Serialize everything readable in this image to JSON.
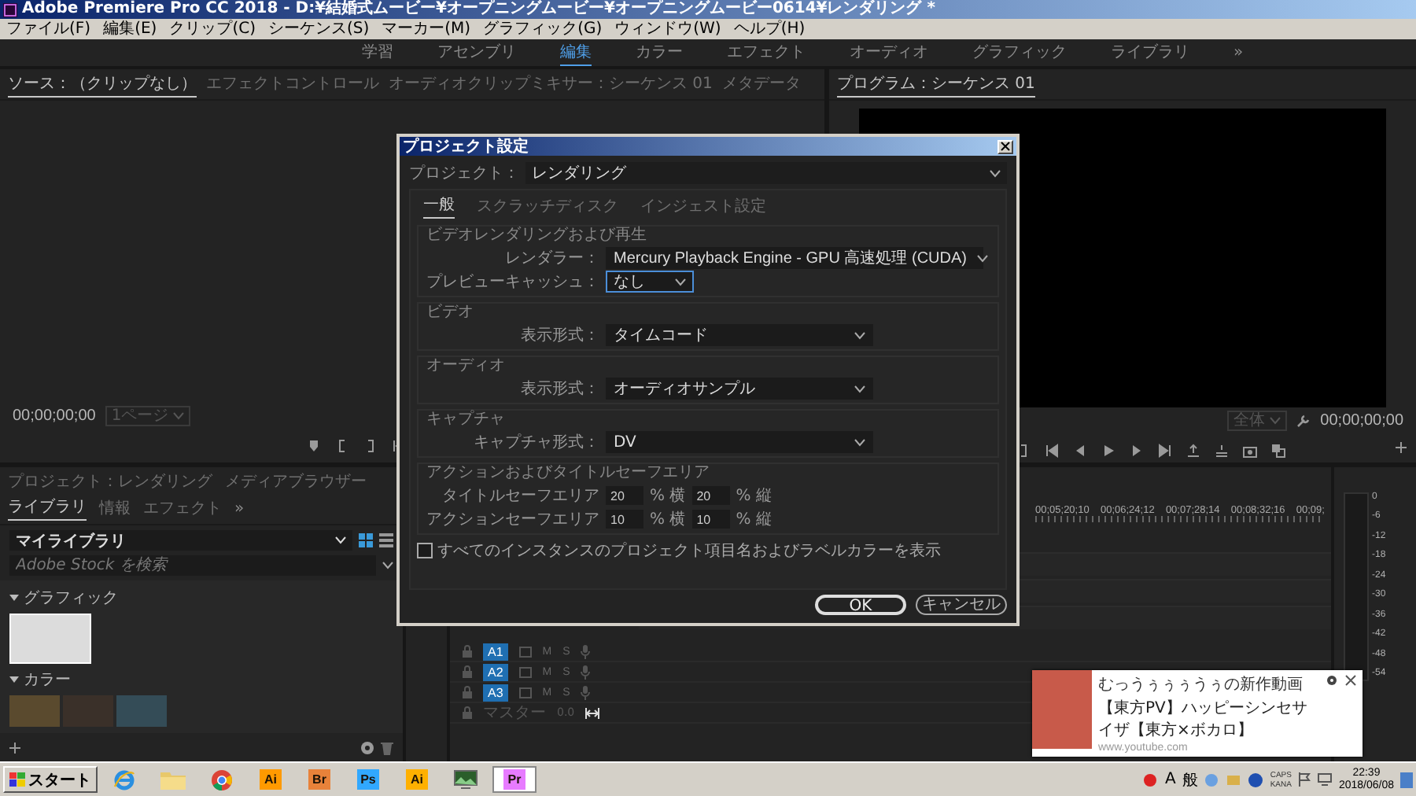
{
  "window": {
    "title": "Adobe Premiere Pro CC 2018 - D:¥結婚式ムービー¥オープニングムービー¥オープニングムービー0614¥レンダリング *"
  },
  "menu": [
    "ファイル(F)",
    "編集(E)",
    "クリップ(C)",
    "シーケンス(S)",
    "マーカー(M)",
    "グラフィック(G)",
    "ウィンドウ(W)",
    "ヘルプ(H)"
  ],
  "workspaces": [
    {
      "label": "学習",
      "selected": false
    },
    {
      "label": "アセンブリ",
      "selected": false
    },
    {
      "label": "編集",
      "selected": true
    },
    {
      "label": "カラー",
      "selected": false
    },
    {
      "label": "エフェクト",
      "selected": false
    },
    {
      "label": "オーディオ",
      "selected": false
    },
    {
      "label": "グラフィック",
      "selected": false
    },
    {
      "label": "ライブラリ",
      "selected": false
    }
  ],
  "workspace_more": "»",
  "source_panel": {
    "tabs": [
      {
        "label": "ソース：（クリップなし）",
        "selected": true
      },
      {
        "label": "エフェクトコントロール",
        "selected": false
      },
      {
        "label": "オーディオクリップミキサー：シーケンス 01",
        "selected": false
      },
      {
        "label": "メタデータ",
        "selected": false
      }
    ],
    "timecode": "00;00;00;00",
    "zoom": "1ページ"
  },
  "program_panel": {
    "tabs": [
      {
        "label": "プログラム：シーケンス 01",
        "selected": true
      }
    ],
    "zoom": "全体",
    "timecode": "00;00;00;00"
  },
  "project_panel": {
    "tabs": [
      {
        "label": "プロジェクト：レンダリング",
        "selected": false
      },
      {
        "label": "メディアブラウザー",
        "selected": false
      },
      {
        "label": "ライブラリ",
        "selected": true
      },
      {
        "label": "情報",
        "selected": false
      },
      {
        "label": "エフェクト",
        "selected": false
      }
    ],
    "more": "»",
    "library": "マイライブラリ",
    "search_placeholder": "Adobe Stock を検索",
    "sections": [
      {
        "kind": "graphics",
        "title": "グラフィック",
        "expanded": true
      },
      {
        "kind": "colors",
        "title": "カラー",
        "expanded": true,
        "swatches": [
          {
            "color": "#5a4a2e"
          },
          {
            "color": "#3a3029"
          },
          {
            "color": "#344c57"
          }
        ]
      }
    ]
  },
  "timeline": {
    "ruler": [
      "00;05;20;10",
      "00;06;24;12",
      "00;07;28;14",
      "00;08;32;16",
      "00;09;"
    ],
    "tracks": [
      {
        "name": "A1",
        "targeted": true,
        "mute": "M",
        "solo": "S"
      },
      {
        "name": "A2",
        "targeted": true,
        "mute": "M",
        "solo": "S"
      },
      {
        "name": "A3",
        "targeted": true,
        "mute": "M",
        "solo": "S"
      }
    ],
    "master": {
      "label": "マスター",
      "value": "0.0"
    }
  },
  "meter": {
    "ticks": [
      "0",
      "-6",
      "-12",
      "-18",
      "-24",
      "-30",
      "-36",
      "-42",
      "-48",
      "-54"
    ]
  },
  "dialog": {
    "title": "プロジェクト設定",
    "project_label": "プロジェクト：",
    "project_value": "レンダリング",
    "tabs": [
      {
        "label": "一般",
        "selected": true
      },
      {
        "label": "スクラッチディスク",
        "selected": false
      },
      {
        "label": "インジェスト設定",
        "selected": false
      }
    ],
    "sections": [
      {
        "title": "ビデオレンダリングおよび再生",
        "rows": [
          {
            "kind": "dropdown",
            "label": "レンダラー：",
            "value": "Mercury Playback Engine - GPU 高速処理 (CUDA)",
            "focused": false
          },
          {
            "kind": "short_dropdown",
            "label": "プレビューキャッシュ：",
            "value": "なし",
            "focused": true
          }
        ]
      },
      {
        "title": "ビデオ",
        "rows": [
          {
            "kind": "dropdown",
            "label": "表示形式：",
            "value": "タイムコード",
            "focused": false
          }
        ]
      },
      {
        "title": "オーディオ",
        "rows": [
          {
            "kind": "dropdown",
            "label": "表示形式：",
            "value": "オーディオサンプル",
            "focused": false
          }
        ]
      },
      {
        "title": "キャプチャ",
        "rows": [
          {
            "kind": "dropdown",
            "label": "キャプチャ形式：",
            "value": "DV",
            "focused": false
          }
        ]
      },
      {
        "title": "アクションおよびタイトルセーフエリア",
        "rows": [
          {
            "kind": "safe_area",
            "label": "タイトルセーフエリア",
            "h": "20",
            "h_unit": "% 横",
            "v": "20",
            "v_unit": "% 縦"
          },
          {
            "kind": "safe_area",
            "label": "アクションセーフエリア",
            "h": "10",
            "h_unit": "% 横",
            "v": "10",
            "v_unit": "% 縦"
          }
        ]
      }
    ],
    "show_labels": {
      "label": "すべてのインスタンスのプロジェクト項目名およびラベルカラーを表示",
      "checked": false
    },
    "buttons": [
      {
        "label": "OK",
        "kind": "primary"
      },
      {
        "label": "キャンセル",
        "kind": "secondary"
      }
    ]
  },
  "notification": {
    "title": "むっうぅぅぅうぅの新作動画",
    "body": "【東方PV】ハッピーシンセサイザ【東方×ボカロ】",
    "source": "www.youtube.com"
  },
  "taskbar": {
    "start": "スタート",
    "apps": [
      {
        "kind": "ie",
        "selected": false
      },
      {
        "kind": "folder",
        "selected": false
      },
      {
        "kind": "chrome",
        "selected": false
      },
      {
        "kind": "tile",
        "label": "Ai",
        "color": "#ff9a00",
        "selected": false
      },
      {
        "kind": "tile",
        "label": "Br",
        "color": "#e8823a",
        "selected": false
      },
      {
        "kind": "tile",
        "label": "Ps",
        "color": "#31a8ff",
        "selected": false
      },
      {
        "kind": "tile",
        "label": "Ai",
        "color": "#ffb000",
        "selected": false
      },
      {
        "kind": "photo",
        "selected": false
      },
      {
        "kind": "tile",
        "label": "Pr",
        "color": "#e77bff",
        "selected": true
      }
    ],
    "tray": {
      "ime_mode": "A",
      "ime_input": "般",
      "caps": "CAPS",
      "kana": "KANA",
      "time": "22:39",
      "date": "2018/06/08"
    }
  }
}
